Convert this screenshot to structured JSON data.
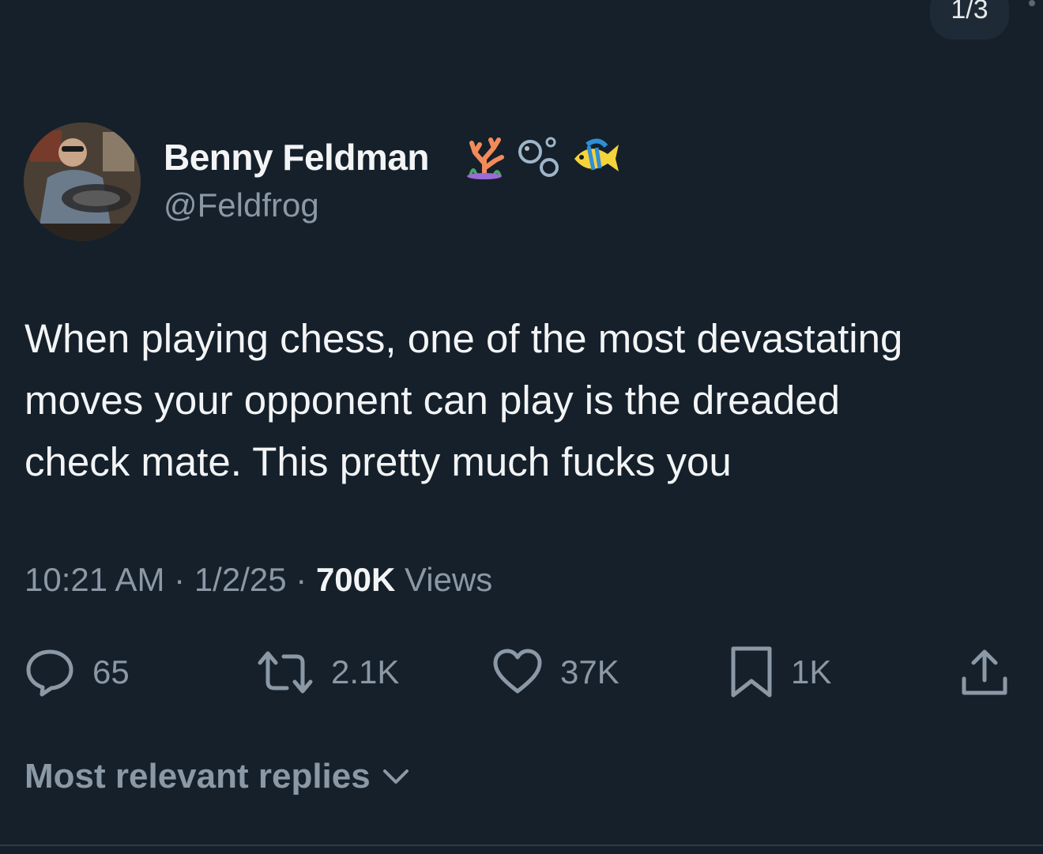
{
  "pager": {
    "label": "1/3"
  },
  "tweet": {
    "author_name": "Benny Feldman",
    "author_name_emoji": [
      "coral-emoji",
      "bubbles-emoji",
      "tropical-fish-emoji"
    ],
    "handle": "@Feldfrog",
    "text": "When playing chess, one of the most devastating\nmoves your opponent can play is the dreaded\ncheck mate. This pretty much fucks you",
    "time": "10:21 AM",
    "separator": "·",
    "date": "1/2/25",
    "views_count": "700K",
    "views_label": "Views"
  },
  "actions": {
    "replies": "65",
    "reposts": "2.1K",
    "likes": "37K",
    "bookmarks": "1K"
  },
  "replies_sort": {
    "label": "Most relevant replies"
  },
  "colors": {
    "background": "#15202b",
    "text_primary": "#f3f4f5",
    "text_secondary": "#8b98a5"
  }
}
